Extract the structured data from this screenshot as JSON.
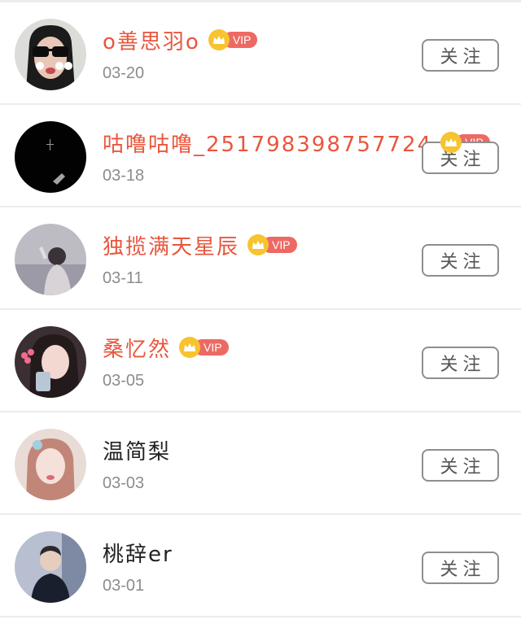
{
  "list": {
    "follow_label": "关注",
    "vip_label": "VIP",
    "items": [
      {
        "name": "o善思羽o",
        "date": "03-20",
        "vip": true
      },
      {
        "name": "咕噜咕噜_251798398757724",
        "date": "03-18",
        "vip": true
      },
      {
        "name": "独揽满天星辰",
        "date": "03-11",
        "vip": true
      },
      {
        "name": "桑忆然",
        "date": "03-05",
        "vip": true
      },
      {
        "name": "温简梨",
        "date": "03-03",
        "vip": false
      },
      {
        "name": "桃辞er",
        "date": "03-01",
        "vip": false
      }
    ]
  },
  "colors": {
    "vip_name": "#e8563d",
    "normal_name": "#222222",
    "date": "#8c8c8c",
    "vip_badge": "#ec6a63",
    "crown": "#f7c430",
    "divider": "#ececec"
  },
  "icons": {
    "vip_badge": "crown-icon"
  }
}
